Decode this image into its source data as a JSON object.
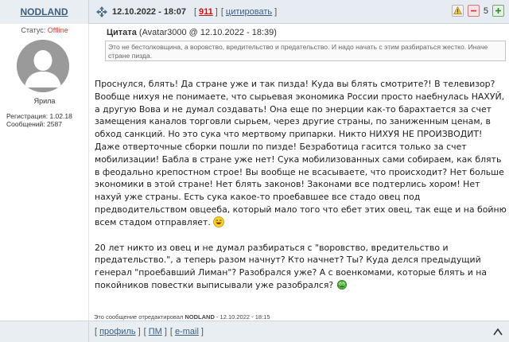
{
  "author": {
    "name": "NODLAND",
    "status_label": "Статус:",
    "status_value": "Offline",
    "rank": "Ярила",
    "reg_label": "Регистрация:",
    "reg_value": "1.02.18",
    "posts_label": "Сообщений:",
    "posts_value": "2587"
  },
  "header": {
    "date": "12.10.2022 - 18:07",
    "post_number": "911",
    "quote_label": "цитировать",
    "rep_count": "5"
  },
  "quote": {
    "label": "Цитата",
    "meta": "(Avatar3000 @ 12.10.2022 - 18:39)",
    "text": "Это не бестолковщина, а воровство, вредительство и предательство. И надо начать с этим разбираться жестко. Иначе стране пизда."
  },
  "body": {
    "p1": "Проснулся, блять! Да стране уже и так пизда! Куда вы блять смотрите?! В телевизор? Вообще нихуя не понимаете, что сырьевая экономика России просто наебнулась НАХУЙ, а другую Вова и не думал создавать! Она еще по энерции как-то барахтается за счет замещения каналов торговли сырьем, через другие страны, по заниженным ценам, в обход санкций. Но это сука что мертвому припарки. Никто НИХУЯ НЕ ПРОИЗВОДИТ! Даже отверточные сборки пошли по пизде! Безработица гасится только за счет мобилизации! Бабла в стране уже нет! Сука мобилизованных сами собираем, как блять в феодально крепостном строе! Вы вообще не всасываете, что происходит? Нет больше экономики в этой стране! Нет блять законов! Законами все подтерлись хором! Нет нахуй уже страны. Есть сука какое-то проебавшее все стадо овец под предводительством овцееба, который мало того что ебет этих овец, так еще и на бойню всем стадом отправляет.",
    "p2": "20 лет никто из овец и не думал разбираться с \"воровство, вредительство и предательство.\", а теперь разом начнут? Кто начнет? Ты? Куда делся предыдущий генерал \"проебавший Лиман\"? Разобрался уже? А с военкомами, которые блять и на покойников повестки выписывали уже разобрался?"
  },
  "edited": {
    "prefix": "Это сообщение отредактировал",
    "editor": "NODLAND",
    "suffix": "- 12.10.2022 - 18:15"
  },
  "footer": {
    "profile": "профиль",
    "pm": "ПМ",
    "email": "e-mail"
  },
  "icons": {
    "header_move": "crosshair-move-icon",
    "report": "report-icon",
    "rep_minus": "minus-icon",
    "rep_plus": "plus-icon",
    "smiley1": "laughing-smiley-icon",
    "smiley2": "thinking-smiley-icon",
    "up": "scroll-up-icon"
  },
  "colors": {
    "link": "#3b5f7e",
    "post_number": "#cc1111",
    "offline": "#d43b3b"
  }
}
